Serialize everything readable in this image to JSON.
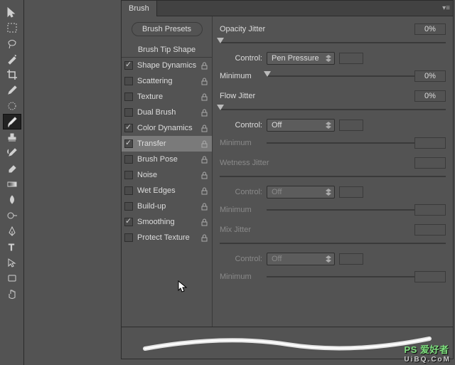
{
  "panel": {
    "tab": "Brush",
    "presets_button": "Brush Presets",
    "tip_shape": "Brush Tip Shape"
  },
  "options": [
    {
      "label": "Shape Dynamics",
      "checked": true,
      "locked": true,
      "selected": false
    },
    {
      "label": "Scattering",
      "checked": false,
      "locked": true,
      "selected": false
    },
    {
      "label": "Texture",
      "checked": false,
      "locked": true,
      "selected": false
    },
    {
      "label": "Dual Brush",
      "checked": false,
      "locked": true,
      "selected": false
    },
    {
      "label": "Color Dynamics",
      "checked": true,
      "locked": true,
      "selected": false
    },
    {
      "label": "Transfer",
      "checked": true,
      "locked": true,
      "selected": true
    },
    {
      "label": "Brush Pose",
      "checked": false,
      "locked": true,
      "selected": false
    },
    {
      "label": "Noise",
      "checked": false,
      "locked": true,
      "selected": false
    },
    {
      "label": "Wet Edges",
      "checked": false,
      "locked": true,
      "selected": false
    },
    {
      "label": "Build-up",
      "checked": false,
      "locked": true,
      "selected": false
    },
    {
      "label": "Smoothing",
      "checked": true,
      "locked": true,
      "selected": false
    },
    {
      "label": "Protect Texture",
      "checked": false,
      "locked": true,
      "selected": false
    }
  ],
  "transfer": {
    "opacity": {
      "title": "Opacity Jitter",
      "value": "0%",
      "control_label": "Control:",
      "control_value": "Pen Pressure",
      "minimum_label": "Minimum",
      "minimum_value": "0%",
      "enabled": true
    },
    "flow": {
      "title": "Flow Jitter",
      "value": "0%",
      "control_label": "Control:",
      "control_value": "Off",
      "minimum_label": "Minimum",
      "minimum_value": "",
      "enabled": true
    },
    "wetness": {
      "title": "Wetness Jitter",
      "value": "",
      "control_label": "Control:",
      "control_value": "Off",
      "minimum_label": "Minimum",
      "minimum_value": "",
      "enabled": false
    },
    "mix": {
      "title": "Mix Jitter",
      "value": "",
      "control_label": "Control:",
      "control_value": "Off",
      "minimum_label": "Minimum",
      "minimum_value": "",
      "enabled": false
    }
  },
  "watermark": {
    "line1": "PS 爱好者",
    "line2": "UiBQ.CoM"
  }
}
